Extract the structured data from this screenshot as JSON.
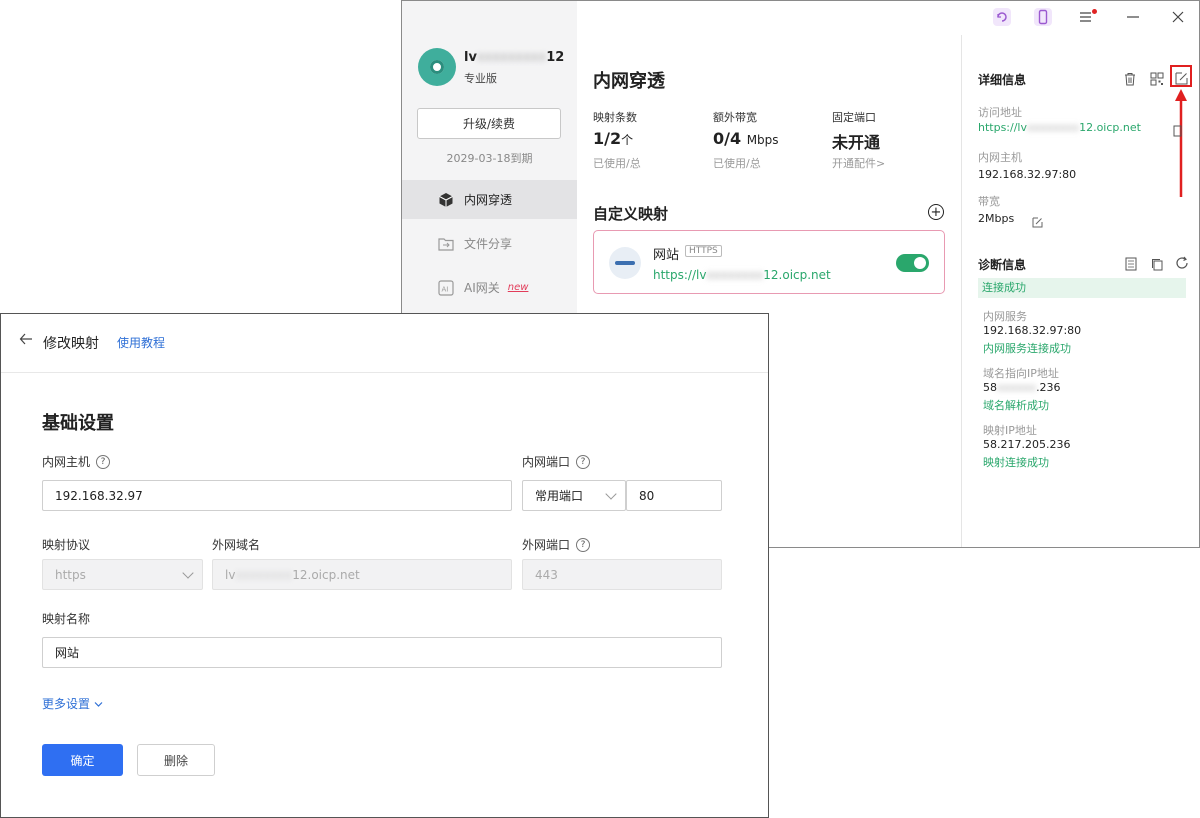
{
  "sidebar": {
    "user_prefix": "lv",
    "user_suffix": "12",
    "edition": "专业版",
    "upgrade_label": "升级/续费",
    "expire_date": "2029-03-18到期",
    "nav": [
      {
        "label": "内网穿透",
        "icon": "cube-icon",
        "active": true
      },
      {
        "label": "文件分享",
        "icon": "folder-share-icon",
        "active": false
      },
      {
        "label": "AI网关",
        "icon": "ai-icon",
        "active": false,
        "badge": "new"
      }
    ]
  },
  "main": {
    "title": "内网穿透",
    "stats": [
      {
        "label": "映射条数",
        "value": "1/2",
        "unit": "个",
        "sub": "已使用/总"
      },
      {
        "label": "额外带宽",
        "value": "0/4",
        "unit": "Mbps",
        "sub": "已使用/总"
      },
      {
        "label": "固定端口",
        "value": "未开通",
        "unit": "",
        "sub": "开通配件>"
      }
    ],
    "custom_title": "自定义映射",
    "add_icon": "+",
    "mapping": {
      "name": "网站",
      "tag": "HTTPS",
      "url_prefix": "https://lv",
      "url_suffix": "12.oicp.net",
      "enabled": true
    }
  },
  "details": {
    "title": "详细信息",
    "access_label": "访问地址",
    "access_prefix": "https://lv",
    "access_suffix": "12.oicp.net",
    "host_label": "内网主机",
    "host_value": "192.168.32.97:80",
    "bandwidth_label": "带宽",
    "bandwidth_value": "2Mbps"
  },
  "diagnosis": {
    "title": "诊断信息",
    "status": "连接成功",
    "items": [
      {
        "label": "内网服务",
        "value": "192.168.32.97:80",
        "result": "内网服务连接成功"
      },
      {
        "label": "域名指向IP地址",
        "value_prefix": "58",
        "value_suffix": ".236",
        "result": "域名解析成功"
      },
      {
        "label": "映射IP地址",
        "value": "58.217.205.236",
        "result": "映射连接成功"
      }
    ]
  },
  "dialog": {
    "title": "修改映射",
    "tutorial_link": "使用教程",
    "section_title": "基础设置",
    "host_label": "内网主机",
    "host_value": "192.168.32.97",
    "port_label": "内网端口",
    "port_type": "常用端口",
    "port_value": "80",
    "protocol_label": "映射协议",
    "protocol_value": "https",
    "domain_label": "外网域名",
    "domain_prefix": "lv",
    "domain_suffix": "12.oicp.net",
    "ext_port_label": "外网端口",
    "ext_port_value": "443",
    "name_label": "映射名称",
    "name_value": "网站",
    "more_label": "更多设置",
    "ok_label": "确定",
    "delete_label": "删除"
  },
  "colors": {
    "accent_green": "#2aa76c",
    "primary_blue": "#2f6ff2",
    "link_blue": "#2e6fd6",
    "highlight_red": "#e02020",
    "card_border_pink": "#e89ab2"
  }
}
